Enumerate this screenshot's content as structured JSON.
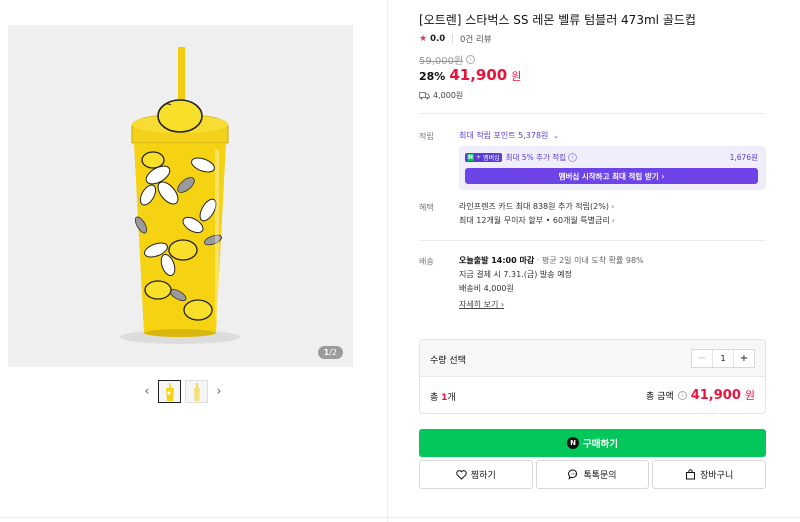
{
  "gallery": {
    "counter_current": "1",
    "counter_total": "/2",
    "prev_arrow": "‹",
    "next_arrow": "›"
  },
  "product": {
    "title": "[오트렌] 스타벅스 SS 레몬 벨류 텀블러 473ml 골드컵",
    "rating": "0.0",
    "reviews": "0건 리뷰",
    "original_price": "59,000원",
    "discount": "28%",
    "price": "41,900",
    "price_unit": "원",
    "shipping_fee": "4,000원"
  },
  "points": {
    "label": "적립",
    "link": "최대 적립 포인트 5,378원",
    "membership_badge": "멤버십",
    "membership_text": "최대 5% 추가 적립",
    "membership_amount": "1,676원",
    "membership_button": "멤버십 시작하고 최대 적립 받기 ›"
  },
  "benefits": {
    "label": "혜택",
    "line1": "라인프렌즈 카드 최대 838원 추가 적립(2%)",
    "line2": "최대 12개월 무이자 할부 • 60개월 특별금리"
  },
  "delivery": {
    "label": "배송",
    "bold": "오늘출발 14:00 마감",
    "rest": " · 평균 2일 이내 도착 확률 98%",
    "line2": "지금 결제 시 7.31.(금) 발송 예정",
    "line3": "배송비 4,000원",
    "detail_link": "자세히 보기 ›"
  },
  "quantity": {
    "label": "수량 선택",
    "value": "1",
    "minus": "−",
    "plus": "+",
    "total_prefix": "총 ",
    "total_count": "1",
    "total_suffix": "개",
    "total_label": "총 금액",
    "total_amount": "41,900",
    "total_unit": "원"
  },
  "actions": {
    "buy": "구매하기",
    "wish": "찜하기",
    "talk": "톡톡문의",
    "cart": "장바구니"
  },
  "colors": {
    "accent_red": "#e8143c",
    "naver_green": "#03c75a",
    "membership_purple": "#6d44e8",
    "tumbler_yellow": "#f5d312"
  }
}
